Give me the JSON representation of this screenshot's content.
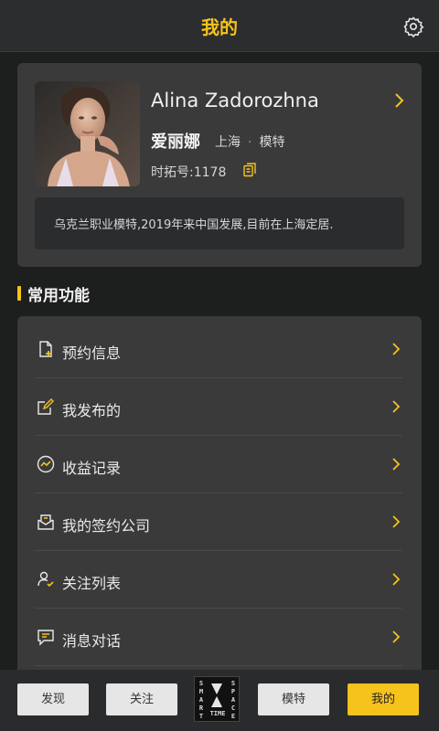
{
  "header": {
    "title": "我的",
    "settings_icon": "gear-icon"
  },
  "profile": {
    "name_en": "Alina Zadorozhna",
    "name_cn": "爱丽娜",
    "city": "上海",
    "separator": "·",
    "role": "模特",
    "account": "时拓号:1178",
    "bio": "乌克兰职业模特,2019年来中国发展,目前在上海定居."
  },
  "section": {
    "title": "常用功能"
  },
  "functions": [
    {
      "label": "预约信息",
      "icon": "document-add-icon"
    },
    {
      "label": "我发布的",
      "icon": "edit-icon"
    },
    {
      "label": "收益记录",
      "icon": "trend-chart-icon"
    },
    {
      "label": "我的签约公司",
      "icon": "mail-envelope-icon"
    },
    {
      "label": "关注列表",
      "icon": "user-check-icon"
    },
    {
      "label": "消息对话",
      "icon": "message-icon"
    }
  ],
  "bottom_nav": {
    "items": [
      {
        "label": "发现",
        "active": false
      },
      {
        "label": "关注",
        "active": false
      },
      {
        "label": "模特",
        "active": false
      },
      {
        "label": "我的",
        "active": true
      }
    ],
    "logo": {
      "left": "SMART",
      "right": "SPACE",
      "bottom": "TIME"
    }
  },
  "colors": {
    "accent": "#f6c21c",
    "background": "#1d1e1e",
    "card": "#3a3a3b"
  }
}
